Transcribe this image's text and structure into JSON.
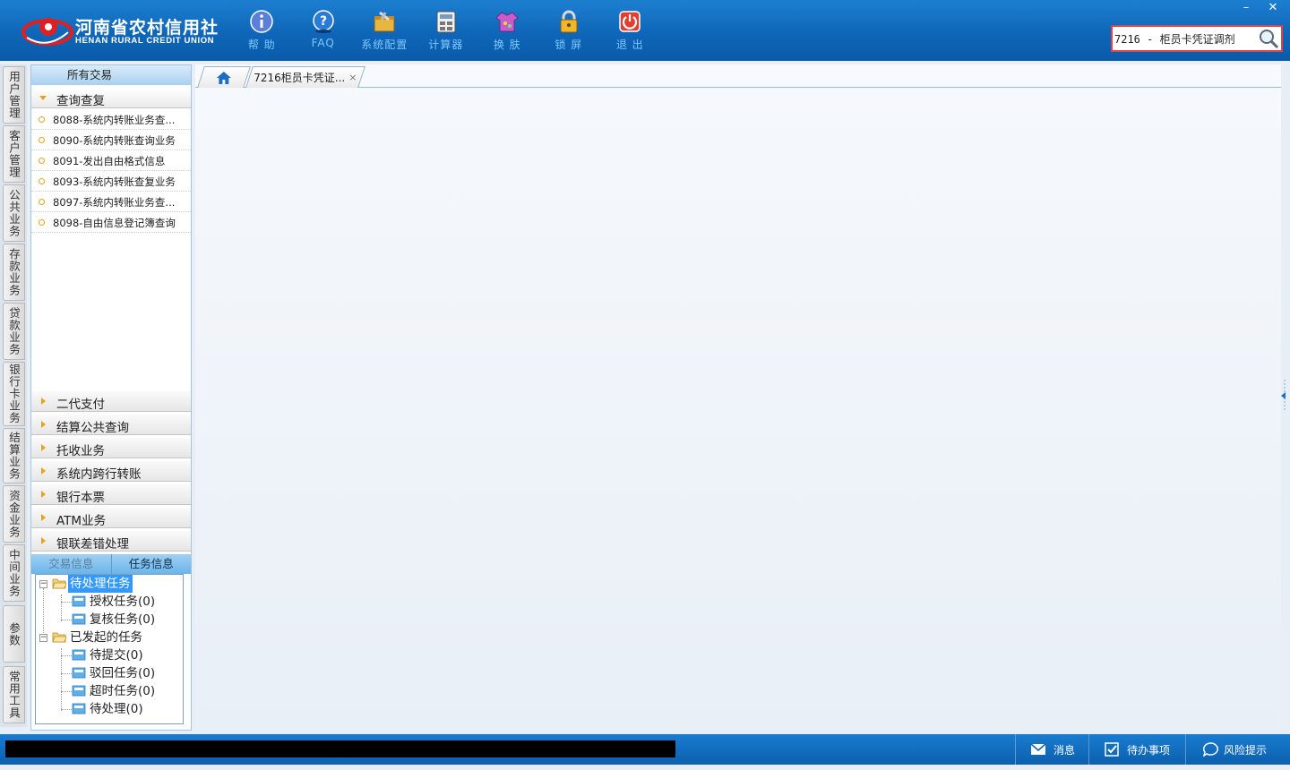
{
  "header": {
    "logo_cn": "河南省农村信用社",
    "logo_en": "HENAN RURAL CREDIT UNION",
    "toolbar": [
      {
        "label": "帮 助",
        "icon": "help-icon"
      },
      {
        "label": "FAQ",
        "icon": "faq-icon"
      },
      {
        "label": "系统配置",
        "icon": "config-icon"
      },
      {
        "label": "计算器",
        "icon": "calculator-icon"
      },
      {
        "label": "换 肤",
        "icon": "skin-icon"
      },
      {
        "label": "锁 屏",
        "icon": "lock-icon"
      },
      {
        "label": "退 出",
        "icon": "exit-icon"
      }
    ],
    "window_controls": {
      "minimize": "–",
      "close": "✕"
    },
    "search": {
      "value": "7216 - 柜员卡凭证调剂"
    }
  },
  "vtabs": [
    "用户管理",
    "客户管理",
    "公共业务",
    "存款业务",
    "贷款业务",
    "银行卡业务",
    "结算业务",
    "资金业务",
    "中间业务",
    "参数",
    "常用工具"
  ],
  "left_panel": {
    "header": "所有交易",
    "open_group": "查询查复",
    "open_items": [
      "8088-系统内转账业务查...",
      "8090-系统内转账查询业务",
      "8091-发出自由格式信息",
      "8093-系统内转账查复业务",
      "8097-系统内转账业务查...",
      "8098-自由信息登记簿查询"
    ],
    "groups": [
      "二代支付",
      "结算公共查询",
      "托收业务",
      "系统内跨行转账",
      "银行本票",
      "ATM业务",
      "银联差错处理"
    ],
    "info_tabs": {
      "trans": "交易信息",
      "task": "任务信息"
    },
    "tree": {
      "pending": {
        "label": "待处理任务",
        "children": [
          "授权任务(0)",
          "复核任务(0)"
        ]
      },
      "initiated": {
        "label": "已发起的任务",
        "children": [
          "待提交(0)",
          "驳回任务(0)",
          "超时任务(0)",
          "待处理(0)"
        ]
      }
    }
  },
  "main": {
    "tab_title": "7216柜员卡凭证...",
    "tab_close": "×"
  },
  "statusbar": {
    "message": "消息",
    "todo": "待办事项",
    "risk": "风险提示"
  },
  "colors": {
    "header_blue": "#0f66b8",
    "toolbar_label": "#7fc8ff",
    "search_border": "#d9434b",
    "selection": "#3399ff"
  }
}
